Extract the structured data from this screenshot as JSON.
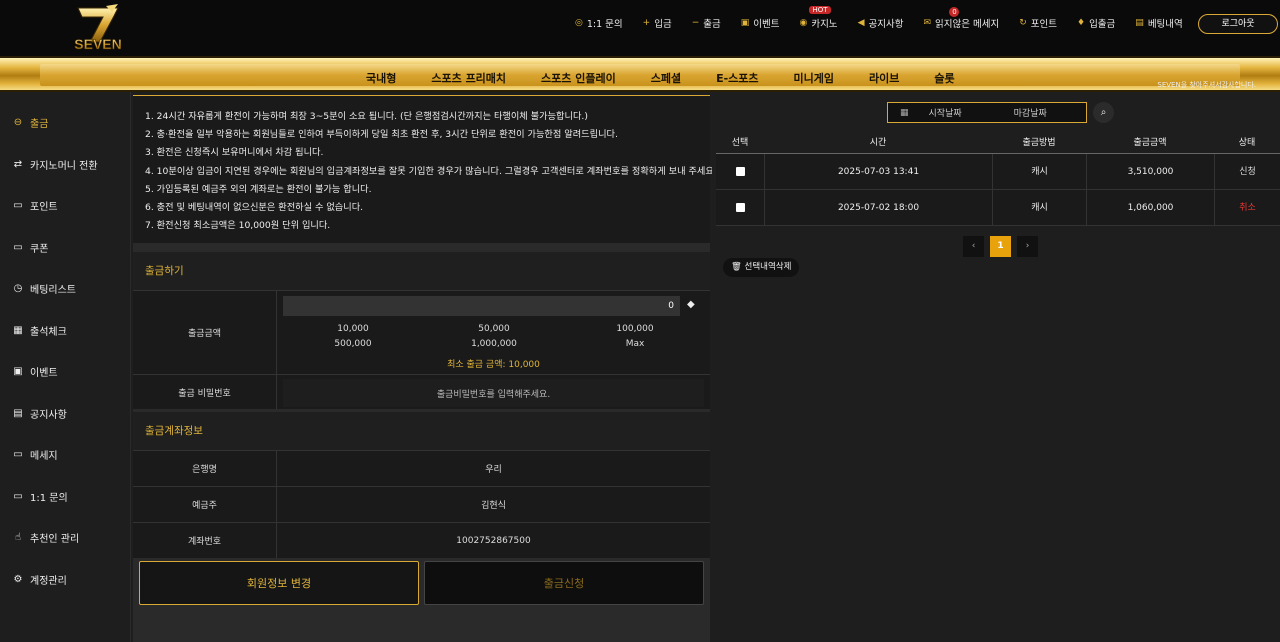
{
  "logo": {
    "text": "SEVEN"
  },
  "topnav": [
    {
      "label": "1:1 문의",
      "icon": "support-icon",
      "glyph": "◎"
    },
    {
      "label": "입금",
      "icon": "plus-icon",
      "glyph": "+"
    },
    {
      "label": "출금",
      "icon": "minus-icon",
      "glyph": "−"
    },
    {
      "label": "이벤트",
      "icon": "gift-icon",
      "glyph": "▣"
    },
    {
      "label": "카지노",
      "icon": "chip-icon",
      "glyph": "◉",
      "badge": "HOT"
    },
    {
      "label": "공지사항",
      "icon": "megaphone-icon",
      "glyph": "◀"
    },
    {
      "label": "읽지않은 메세지",
      "icon": "envelope-icon",
      "glyph": "✉",
      "count": "0"
    },
    {
      "label": "포인트",
      "icon": "refresh-icon",
      "glyph": "↻"
    },
    {
      "label": "입출금",
      "icon": "money-bag-icon",
      "glyph": "♦"
    },
    {
      "label": "베팅내역",
      "icon": "ticket-icon",
      "glyph": "▤"
    }
  ],
  "logout_label": "로그아웃",
  "menu": [
    "국내형",
    "스포츠 프리매치",
    "스포츠 인플레이",
    "스페셜",
    "E-스포츠",
    "미니게임",
    "라이브",
    "슬롯"
  ],
  "slogan": "SEVEN을 찾아주셔서감사합니다.",
  "sidebar": [
    {
      "label": "출금",
      "icon": "withdraw-icon",
      "glyph": "⊖",
      "active": true
    },
    {
      "label": "카지노머니 전환",
      "icon": "exchange-icon",
      "glyph": "⇄"
    },
    {
      "label": "포인트",
      "icon": "point-card-icon",
      "glyph": "▭"
    },
    {
      "label": "쿠폰",
      "icon": "coupon-icon",
      "glyph": "▭"
    },
    {
      "label": "베팅리스트",
      "icon": "history-icon",
      "glyph": "◷"
    },
    {
      "label": "출석체크",
      "icon": "calendar-check-icon",
      "glyph": "▦"
    },
    {
      "label": "이벤트",
      "icon": "gift-icon",
      "glyph": "▣"
    },
    {
      "label": "공지사항",
      "icon": "clipboard-icon",
      "glyph": "▤"
    },
    {
      "label": "메세지",
      "icon": "chat-icon",
      "glyph": "▭"
    },
    {
      "label": "1:1 문의",
      "icon": "comments-icon",
      "glyph": "▭"
    },
    {
      "label": "추천인 관리",
      "icon": "thumbs-up-icon",
      "glyph": "☝"
    },
    {
      "label": "계정관리",
      "icon": "gear-icon",
      "glyph": "⚙"
    }
  ],
  "notices": [
    "1. 24시간 자유롭게 환전이 가능하며 최장 3~5분이 소요 됩니다. (단 은행점검시간까지는 타행이체 불가능합니다.)",
    "2. 충·환전을 일부 악용하는 회원님들로 인하여 부득이하게 당일 최초 환전 후, 3시간 단위로 환전이 가능한점 알려드립니다.",
    "3. 환전은 신청즉시 보유머니에서 차감 됩니다.",
    "4. 10분이상 입금이 지연된 경우에는 회원님의 입금계좌정보를 잘못 기입한 경우가 많습니다. 그럴경우 고객센터로 계좌번호를 정확하게 보내 주세요.",
    "5. 가입등록된 예금주 외의 계좌로는 환전이 불가능 합니다.",
    "6. 충전 및 베팅내역이 없으신분은 환전하실 수 없습니다.",
    "7. 환전신청 최소금액은 10,000원 단위 입니다."
  ],
  "withdraw": {
    "title": "출금하기",
    "amount_label": "출금금액",
    "amount_value": "0",
    "quick": [
      "10,000",
      "50,000",
      "100,000",
      "500,000",
      "1,000,000",
      "Max"
    ],
    "min_text": "최소 출금 금액: 10,000",
    "password_label": "출금 비밀번호",
    "password_placeholder": "출금비밀번호를 입력해주세요."
  },
  "account": {
    "title": "출금계좌정보",
    "bank_label": "은행명",
    "bank_value": "우리",
    "holder_label": "예금주",
    "holder_value": "김현식",
    "number_label": "계좌번호",
    "number_value": "1002752867500"
  },
  "buttons": {
    "edit": "회원정보 변경",
    "apply": "출금신청"
  },
  "filter": {
    "start": "시작날짜",
    "end": "마감날짜"
  },
  "table": {
    "headers": [
      "선택",
      "시간",
      "출금방법",
      "출금금액",
      "상태"
    ],
    "rows": [
      {
        "time": "2025-07-03 13:41",
        "method": "캐시",
        "amount": "3,510,000",
        "status": "신청",
        "status_color": "#dddddd"
      },
      {
        "time": "2025-07-02 18:00",
        "method": "캐시",
        "amount": "1,060,000",
        "status": "취소",
        "status_color": "#e53935"
      }
    ]
  },
  "pagination": {
    "prev": "‹",
    "current": "1",
    "next": "›"
  },
  "delete_label": "선택내역삭제",
  "colors": {
    "gold": "#d9a934",
    "accent": "#e0b43a",
    "active_page": "#e8a20c"
  }
}
